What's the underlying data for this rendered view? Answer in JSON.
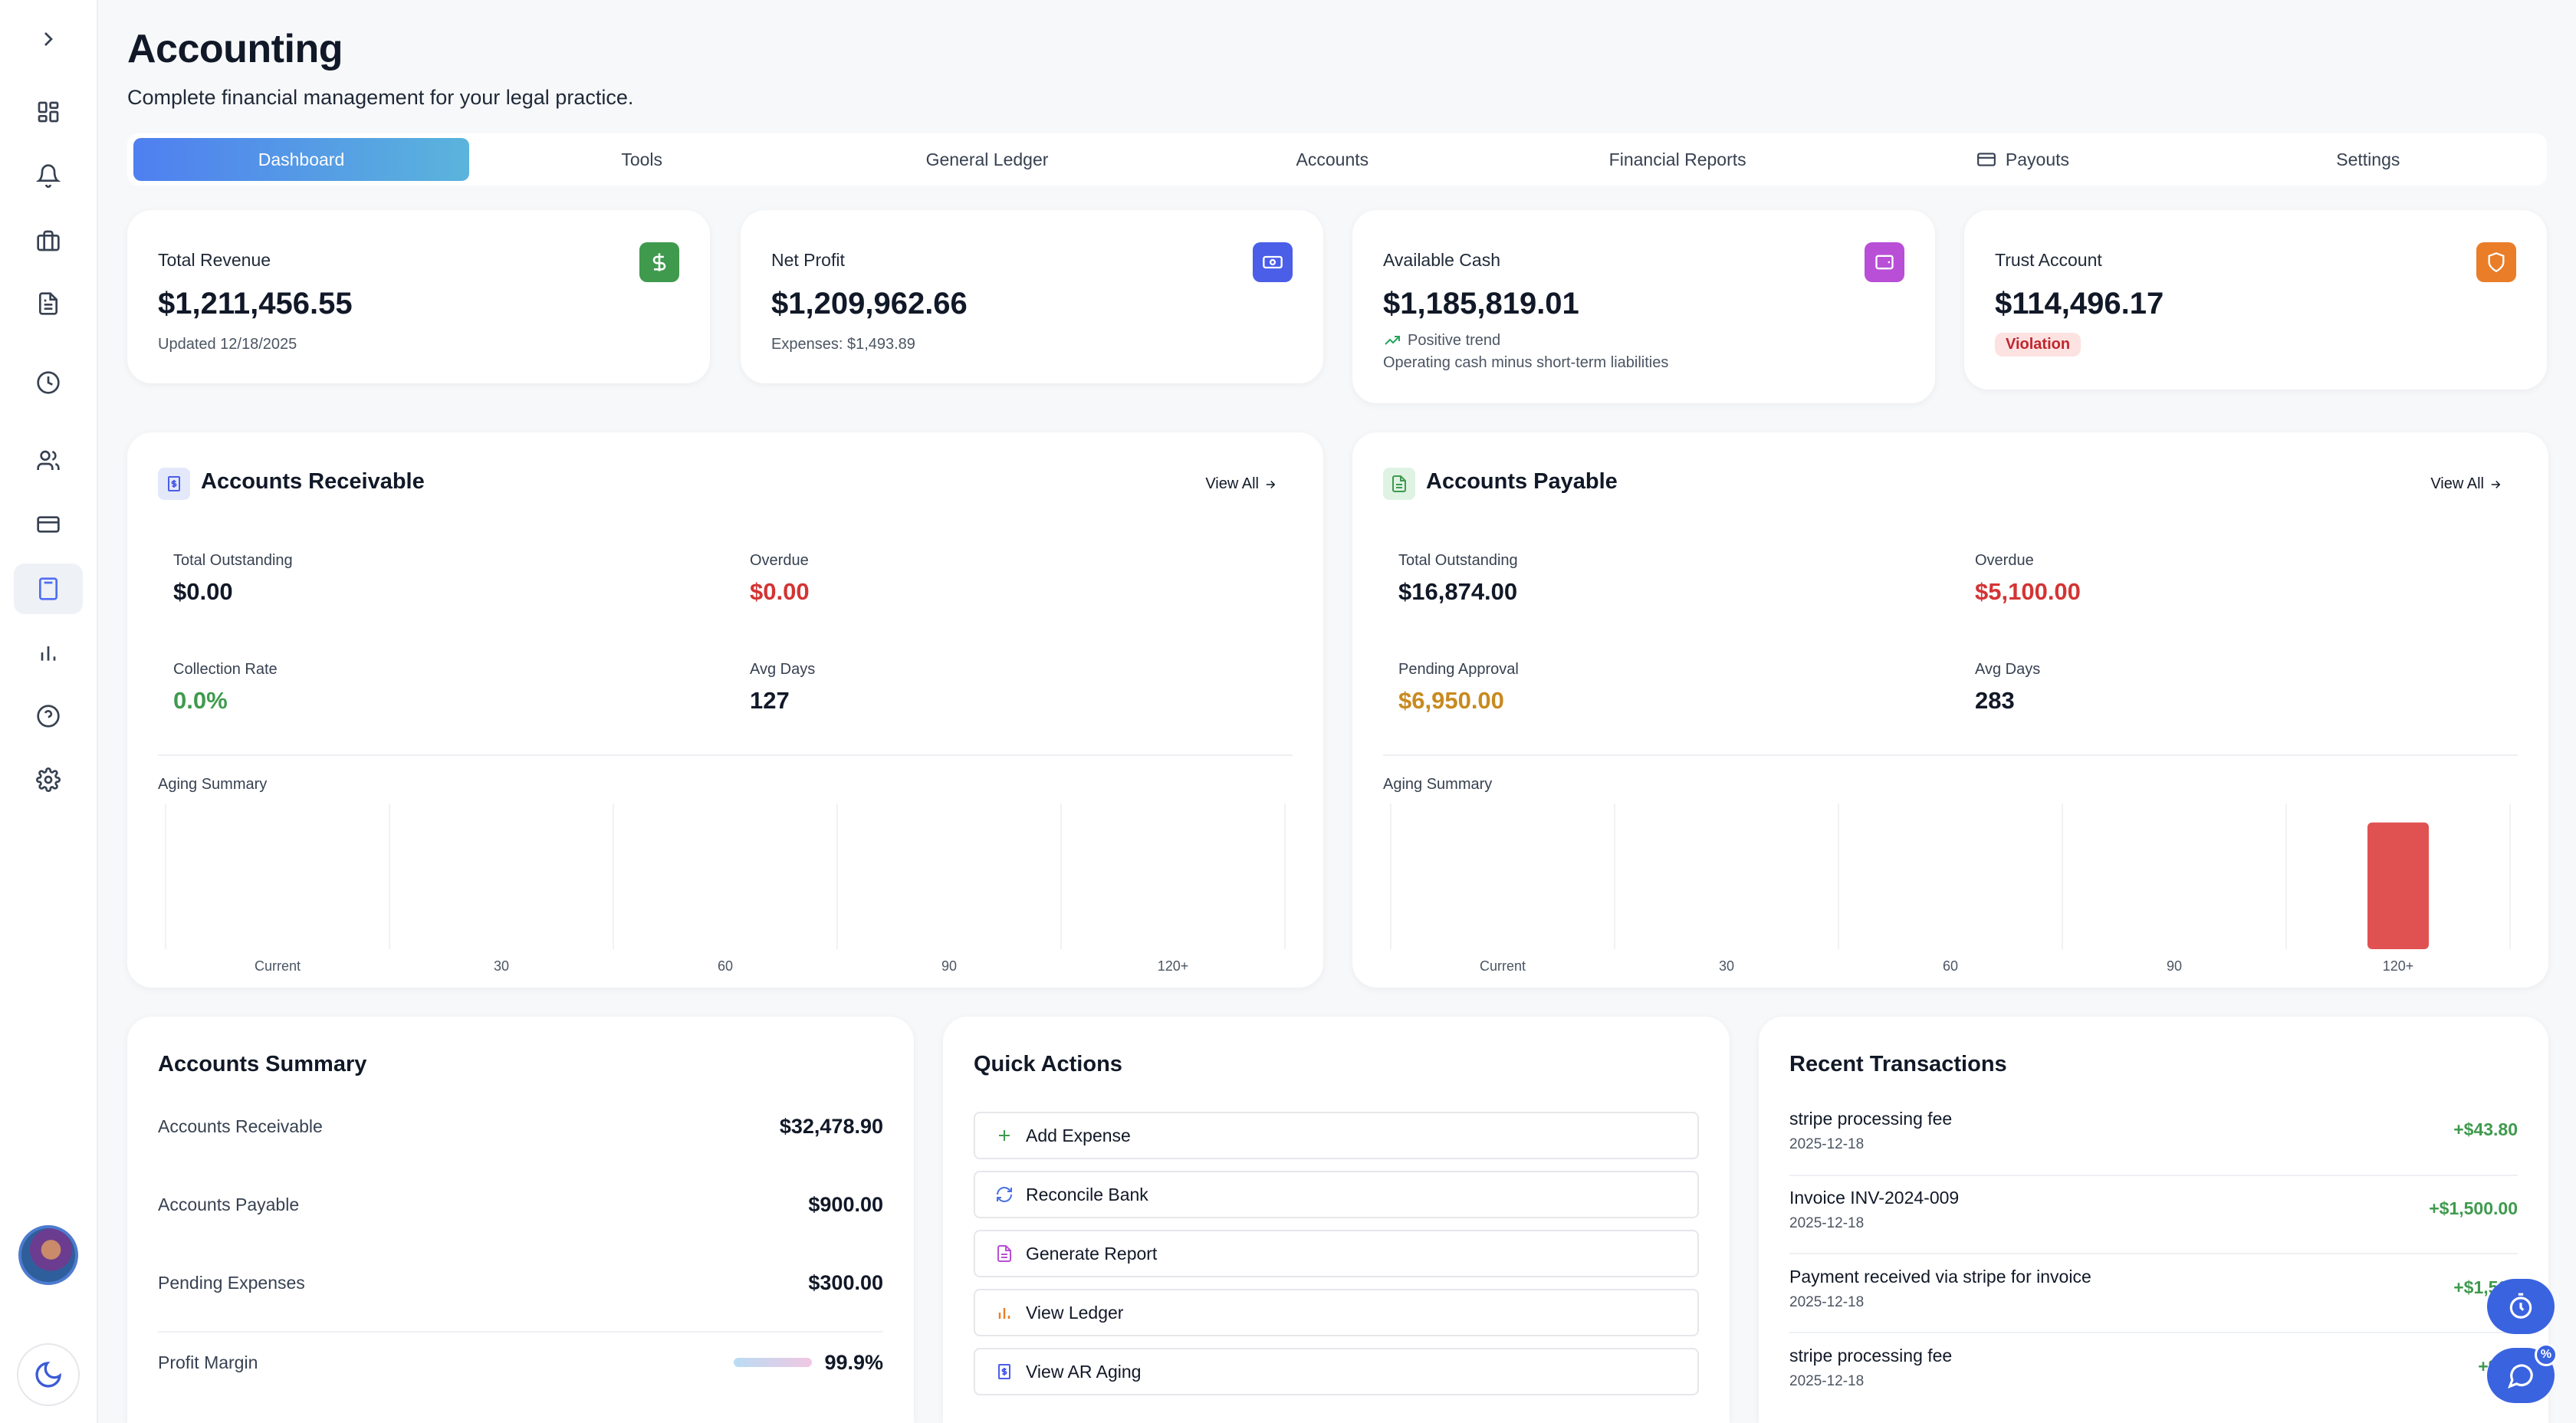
{
  "header": {
    "title": "Accounting",
    "subtitle": "Complete financial management for your legal practice."
  },
  "sidebar": {
    "items": [
      {
        "name": "expand",
        "icon": "chevron-right-icon"
      },
      {
        "name": "dashboard",
        "icon": "grid-icon"
      },
      {
        "name": "notifications",
        "icon": "bell-icon"
      },
      {
        "name": "cases",
        "icon": "briefcase-icon"
      },
      {
        "name": "documents",
        "icon": "document-icon"
      },
      {
        "name": "time",
        "icon": "clock-icon"
      },
      {
        "name": "clients",
        "icon": "users-icon"
      },
      {
        "name": "billing",
        "icon": "credit-card-icon"
      },
      {
        "name": "accounting",
        "icon": "calculator-icon",
        "active": true
      },
      {
        "name": "reports",
        "icon": "bar-chart-icon"
      },
      {
        "name": "help",
        "icon": "help-circle-icon"
      },
      {
        "name": "settings",
        "icon": "gear-icon"
      }
    ]
  },
  "tabs": [
    "Dashboard",
    "Tools",
    "General Ledger",
    "Accounts",
    "Financial Reports",
    "Payouts",
    "Settings"
  ],
  "stats": {
    "revenue": {
      "label": "Total Revenue",
      "value": "$1,211,456.55",
      "sub": "Updated 12/18/2025",
      "color": "#3f9a4e"
    },
    "profit": {
      "label": "Net Profit",
      "value": "$1,209,962.66",
      "sub": "Expenses: $1,493.89",
      "color": "#4a5ee8"
    },
    "cash": {
      "label": "Available Cash",
      "value": "$1,185,819.01",
      "trend": "Positive trend",
      "sub": "Operating cash minus short-term liabilities",
      "color": "#b84fd6"
    },
    "trust": {
      "label": "Trust Account",
      "value": "$114,496.17",
      "badge": "Violation",
      "color": "#ea7d27"
    }
  },
  "receivable": {
    "title": "Accounts Receivable",
    "view_all": "View All",
    "total_outstanding_label": "Total Outstanding",
    "total_outstanding": "$0.00",
    "overdue_label": "Overdue",
    "overdue": "$0.00",
    "collection_rate_label": "Collection Rate",
    "collection_rate": "0.0%",
    "avg_days_label": "Avg Days",
    "avg_days": "127",
    "aging_label": "Aging Summary"
  },
  "payable": {
    "title": "Accounts Payable",
    "view_all": "View All",
    "total_outstanding_label": "Total Outstanding",
    "total_outstanding": "$16,874.00",
    "overdue_label": "Overdue",
    "overdue": "$5,100.00",
    "pending_label": "Pending Approval",
    "pending": "$6,950.00",
    "avg_days_label": "Avg Days",
    "avg_days": "283",
    "aging_label": "Aging Summary"
  },
  "chart_data": [
    {
      "type": "bar",
      "title": "Aging Summary",
      "categories": [
        "Current",
        "30",
        "60",
        "90",
        "120+"
      ],
      "values": [
        0,
        0,
        0,
        0,
        0
      ]
    },
    {
      "type": "bar",
      "title": "Aging Summary",
      "categories": [
        "Current",
        "30",
        "60",
        "90",
        "120+"
      ],
      "values": [
        0,
        0,
        0,
        0,
        5100
      ],
      "bar_color": "#e05252"
    }
  ],
  "summary": {
    "title": "Accounts Summary",
    "rows": [
      {
        "label": "Accounts Receivable",
        "value": "$32,478.90"
      },
      {
        "label": "Accounts Payable",
        "value": "$900.00"
      },
      {
        "label": "Pending Expenses",
        "value": "$300.00"
      },
      {
        "label": "Profit Margin",
        "value": "99.9%",
        "progress": 0.999
      }
    ]
  },
  "quick_actions": {
    "title": "Quick Actions",
    "items": [
      {
        "label": "Add Expense",
        "icon": "plus-icon",
        "color": "#3f9a4e"
      },
      {
        "label": "Reconcile Bank",
        "icon": "refresh-icon",
        "color": "#4a72e0"
      },
      {
        "label": "Generate Report",
        "icon": "document-icon",
        "color": "#b84fd6"
      },
      {
        "label": "View Ledger",
        "icon": "bar-chart-icon",
        "color": "#ea7d27"
      },
      {
        "label": "View AR Aging",
        "icon": "receipt-icon",
        "color": "#4a5ee8"
      }
    ]
  },
  "transactions": {
    "title": "Recent Transactions",
    "rows": [
      {
        "desc": "stripe processing fee",
        "date": "2025-12-18",
        "amount": "+$43.80"
      },
      {
        "desc": "Invoice INV-2024-009",
        "date": "2025-12-18",
        "amount": "+$1,500.00"
      },
      {
        "desc": "Payment received via stripe for invoice",
        "date": "2025-12-18",
        "amount": "+$1,500"
      },
      {
        "desc": "stripe processing fee",
        "date": "2025-12-18",
        "amount": "+$21"
      }
    ]
  }
}
